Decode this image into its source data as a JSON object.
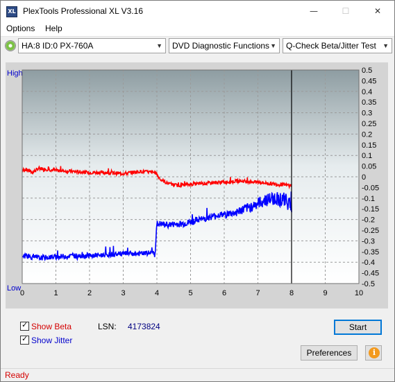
{
  "window": {
    "title": "PlexTools Professional XL V3.16",
    "icon_text": "XL",
    "min_glyph": "—",
    "max_glyph": "☐",
    "close_glyph": "✕"
  },
  "menu": {
    "options": "Options",
    "help": "Help"
  },
  "toolbar": {
    "drive": "HA:8 ID:0  PX-760A",
    "function": "DVD Diagnostic Functions",
    "test": "Q-Check Beta/Jitter Test",
    "arrow": "▼"
  },
  "chart_data": {
    "type": "line",
    "left_labels": {
      "high": "High",
      "low": "Low"
    },
    "x": {
      "min": 0,
      "max": 10,
      "ticks": [
        "0",
        "1",
        "2",
        "3",
        "4",
        "5",
        "6",
        "7",
        "8",
        "9",
        "10"
      ]
    },
    "y_right": {
      "min": -0.5,
      "max": 0.5,
      "ticks": [
        "0.5",
        "0.45",
        "0.4",
        "0.35",
        "0.3",
        "0.25",
        "0.2",
        "0.15",
        "0.1",
        "0.05",
        "0",
        "-0.05",
        "-0.1",
        "-0.15",
        "-0.2",
        "-0.25",
        "-0.3",
        "-0.35",
        "-0.4",
        "-0.45",
        "-0.5"
      ]
    },
    "marker_x": 8.0,
    "grid": true,
    "series": [
      {
        "color": "#ff0000",
        "points": [
          [
            0,
            0.03
          ],
          [
            0.1,
            0.035
          ],
          [
            0.3,
            0.02
          ],
          [
            0.5,
            0.04
          ],
          [
            1,
            0.03
          ],
          [
            1.5,
            0.025
          ],
          [
            2,
            0.02
          ],
          [
            2.5,
            0.02
          ],
          [
            3,
            0.015
          ],
          [
            3.5,
            0.025
          ],
          [
            3.95,
            0.02
          ],
          [
            4.1,
            -0.01
          ],
          [
            4.3,
            -0.03
          ],
          [
            4.6,
            -0.04
          ],
          [
            5,
            -0.035
          ],
          [
            5.5,
            -0.03
          ],
          [
            6,
            -0.025
          ],
          [
            6.5,
            -0.02
          ],
          [
            7,
            -0.025
          ],
          [
            7.5,
            -0.035
          ],
          [
            8,
            -0.04
          ]
        ]
      },
      {
        "color": "#0000ff",
        "points": [
          [
            0,
            -0.37
          ],
          [
            0.2,
            -0.375
          ],
          [
            0.5,
            -0.38
          ],
          [
            1,
            -0.375
          ],
          [
            1.5,
            -0.37
          ],
          [
            2,
            -0.37
          ],
          [
            2.5,
            -0.365
          ],
          [
            3,
            -0.36
          ],
          [
            3.5,
            -0.36
          ],
          [
            3.95,
            -0.355
          ],
          [
            4.0,
            -0.22
          ],
          [
            4.3,
            -0.225
          ],
          [
            4.8,
            -0.22
          ],
          [
            5.3,
            -0.2
          ],
          [
            5.8,
            -0.18
          ],
          [
            6.3,
            -0.17
          ],
          [
            6.8,
            -0.14
          ],
          [
            7.2,
            -0.11
          ],
          [
            7.5,
            -0.1
          ],
          [
            7.8,
            -0.11
          ],
          [
            8,
            -0.13
          ]
        ]
      }
    ]
  },
  "controls": {
    "show_beta_label": "Show Beta",
    "show_jitter_label": "Show Jitter",
    "lsn_label": "LSN:",
    "lsn_value": "4173824",
    "start_label": "Start",
    "preferences_label": "Preferences",
    "info_glyph": "i",
    "beta_color": "#d40000",
    "jitter_color": "#0000cc"
  },
  "status": {
    "text": "Ready",
    "color": "#d40000"
  }
}
